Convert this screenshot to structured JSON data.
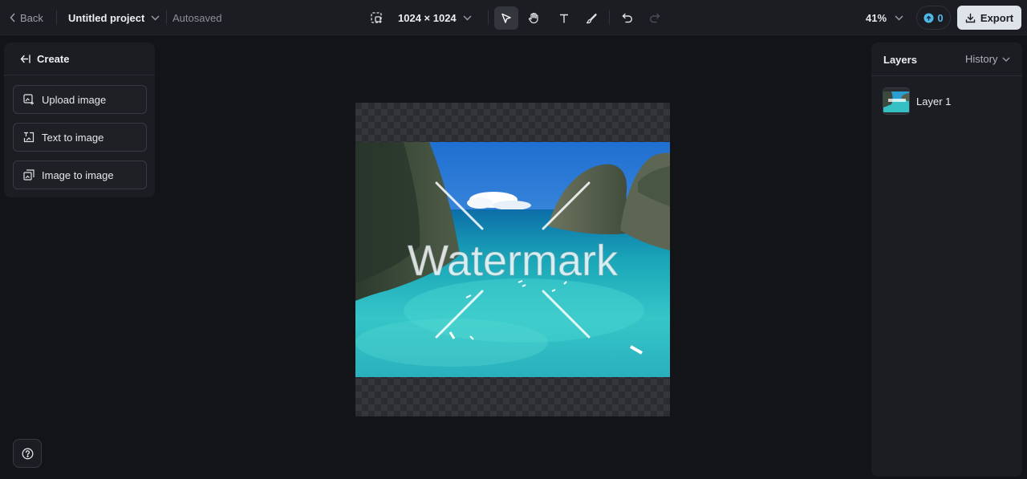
{
  "topbar": {
    "back_label": "Back",
    "project_name": "Untitled project",
    "save_status": "Autosaved",
    "dimensions": "1024 × 1024",
    "tools": [
      "select-tool",
      "hand-tool",
      "text-tool",
      "brush-tool",
      "undo",
      "redo"
    ],
    "active_tool": "select-tool",
    "zoom": "41%",
    "credits": "0",
    "export_label": "Export"
  },
  "left_panel": {
    "header": "Create",
    "buttons": [
      {
        "label": "Upload image",
        "icon": "upload-image-icon"
      },
      {
        "label": "Text to image",
        "icon": "text-to-image-icon"
      },
      {
        "label": "Image to image",
        "icon": "image-to-image-icon"
      }
    ]
  },
  "canvas": {
    "watermark_text": "Watermark"
  },
  "right_panel": {
    "tab_layers": "Layers",
    "tab_history": "History",
    "layers": [
      {
        "name": "Layer 1"
      }
    ]
  },
  "colors": {
    "background": "#121418",
    "panel": "#1b1d22",
    "accent": "#4fb8e8",
    "export_button": "#dfe3ea"
  }
}
